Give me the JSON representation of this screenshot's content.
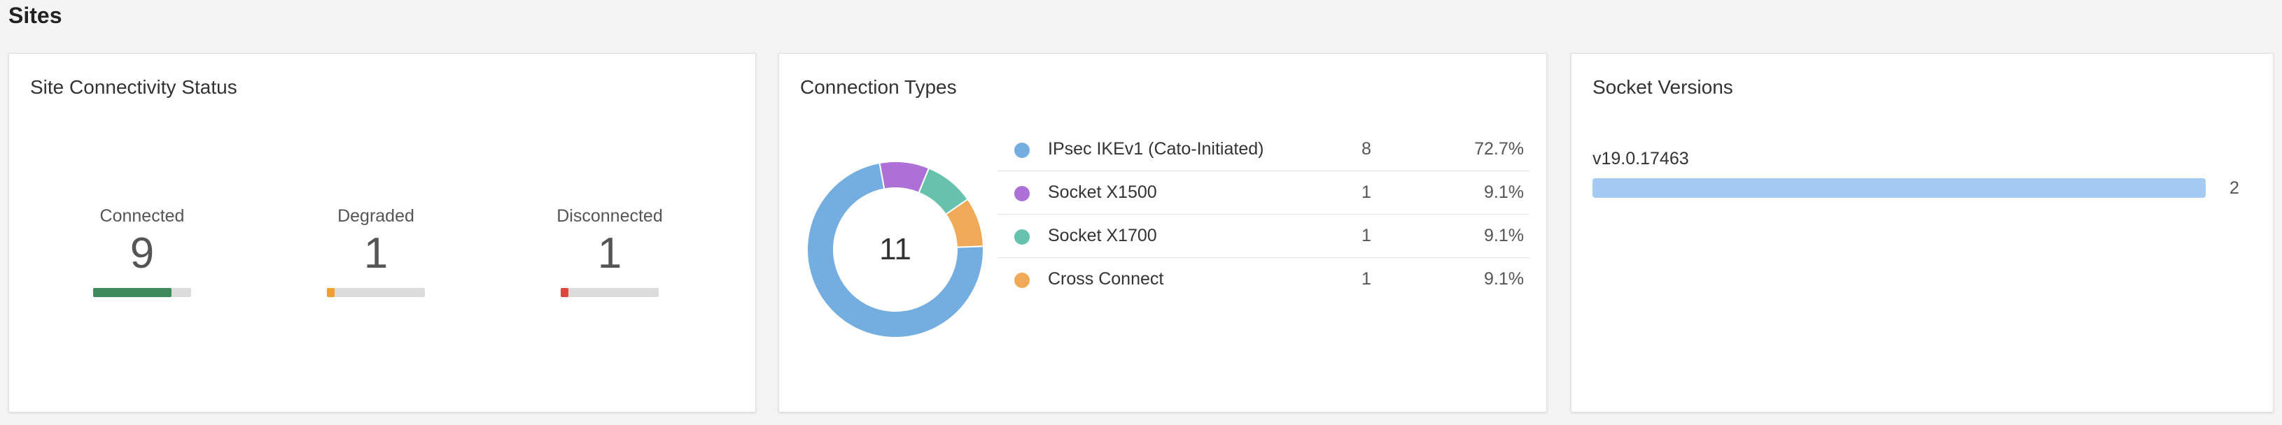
{
  "page": {
    "title": "Sites"
  },
  "status_card": {
    "title": "Site Connectivity Status",
    "items": [
      {
        "label": "Connected",
        "value": "9",
        "fraction": 0.8,
        "color": "#3f8a5b"
      },
      {
        "label": "Degraded",
        "value": "1",
        "fraction": 0.08,
        "color": "#f0a030"
      },
      {
        "label": "Disconnected",
        "value": "1",
        "fraction": 0.08,
        "color": "#e0463c"
      }
    ]
  },
  "connection_card": {
    "title": "Connection Types",
    "total": "11",
    "rows": [
      {
        "name": "IPsec IKEv1 (Cato-Initiated)",
        "count": "8",
        "pct": "72.7%",
        "value": 8,
        "color": "#74aee0"
      },
      {
        "name": "Socket X1500",
        "count": "1",
        "pct": "9.1%",
        "value": 1,
        "color": "#ad70d6"
      },
      {
        "name": "Socket X1700",
        "count": "1",
        "pct": "9.1%",
        "value": 1,
        "color": "#66c2ad"
      },
      {
        "name": "Cross Connect",
        "count": "1",
        "pct": "9.1%",
        "value": 1,
        "color": "#f0a956"
      }
    ]
  },
  "socket_card": {
    "title": "Socket Versions",
    "versions": [
      {
        "name": "v19.0.17463",
        "count": "2",
        "fraction": 1.0,
        "color": "#a3cbf3"
      }
    ]
  }
}
